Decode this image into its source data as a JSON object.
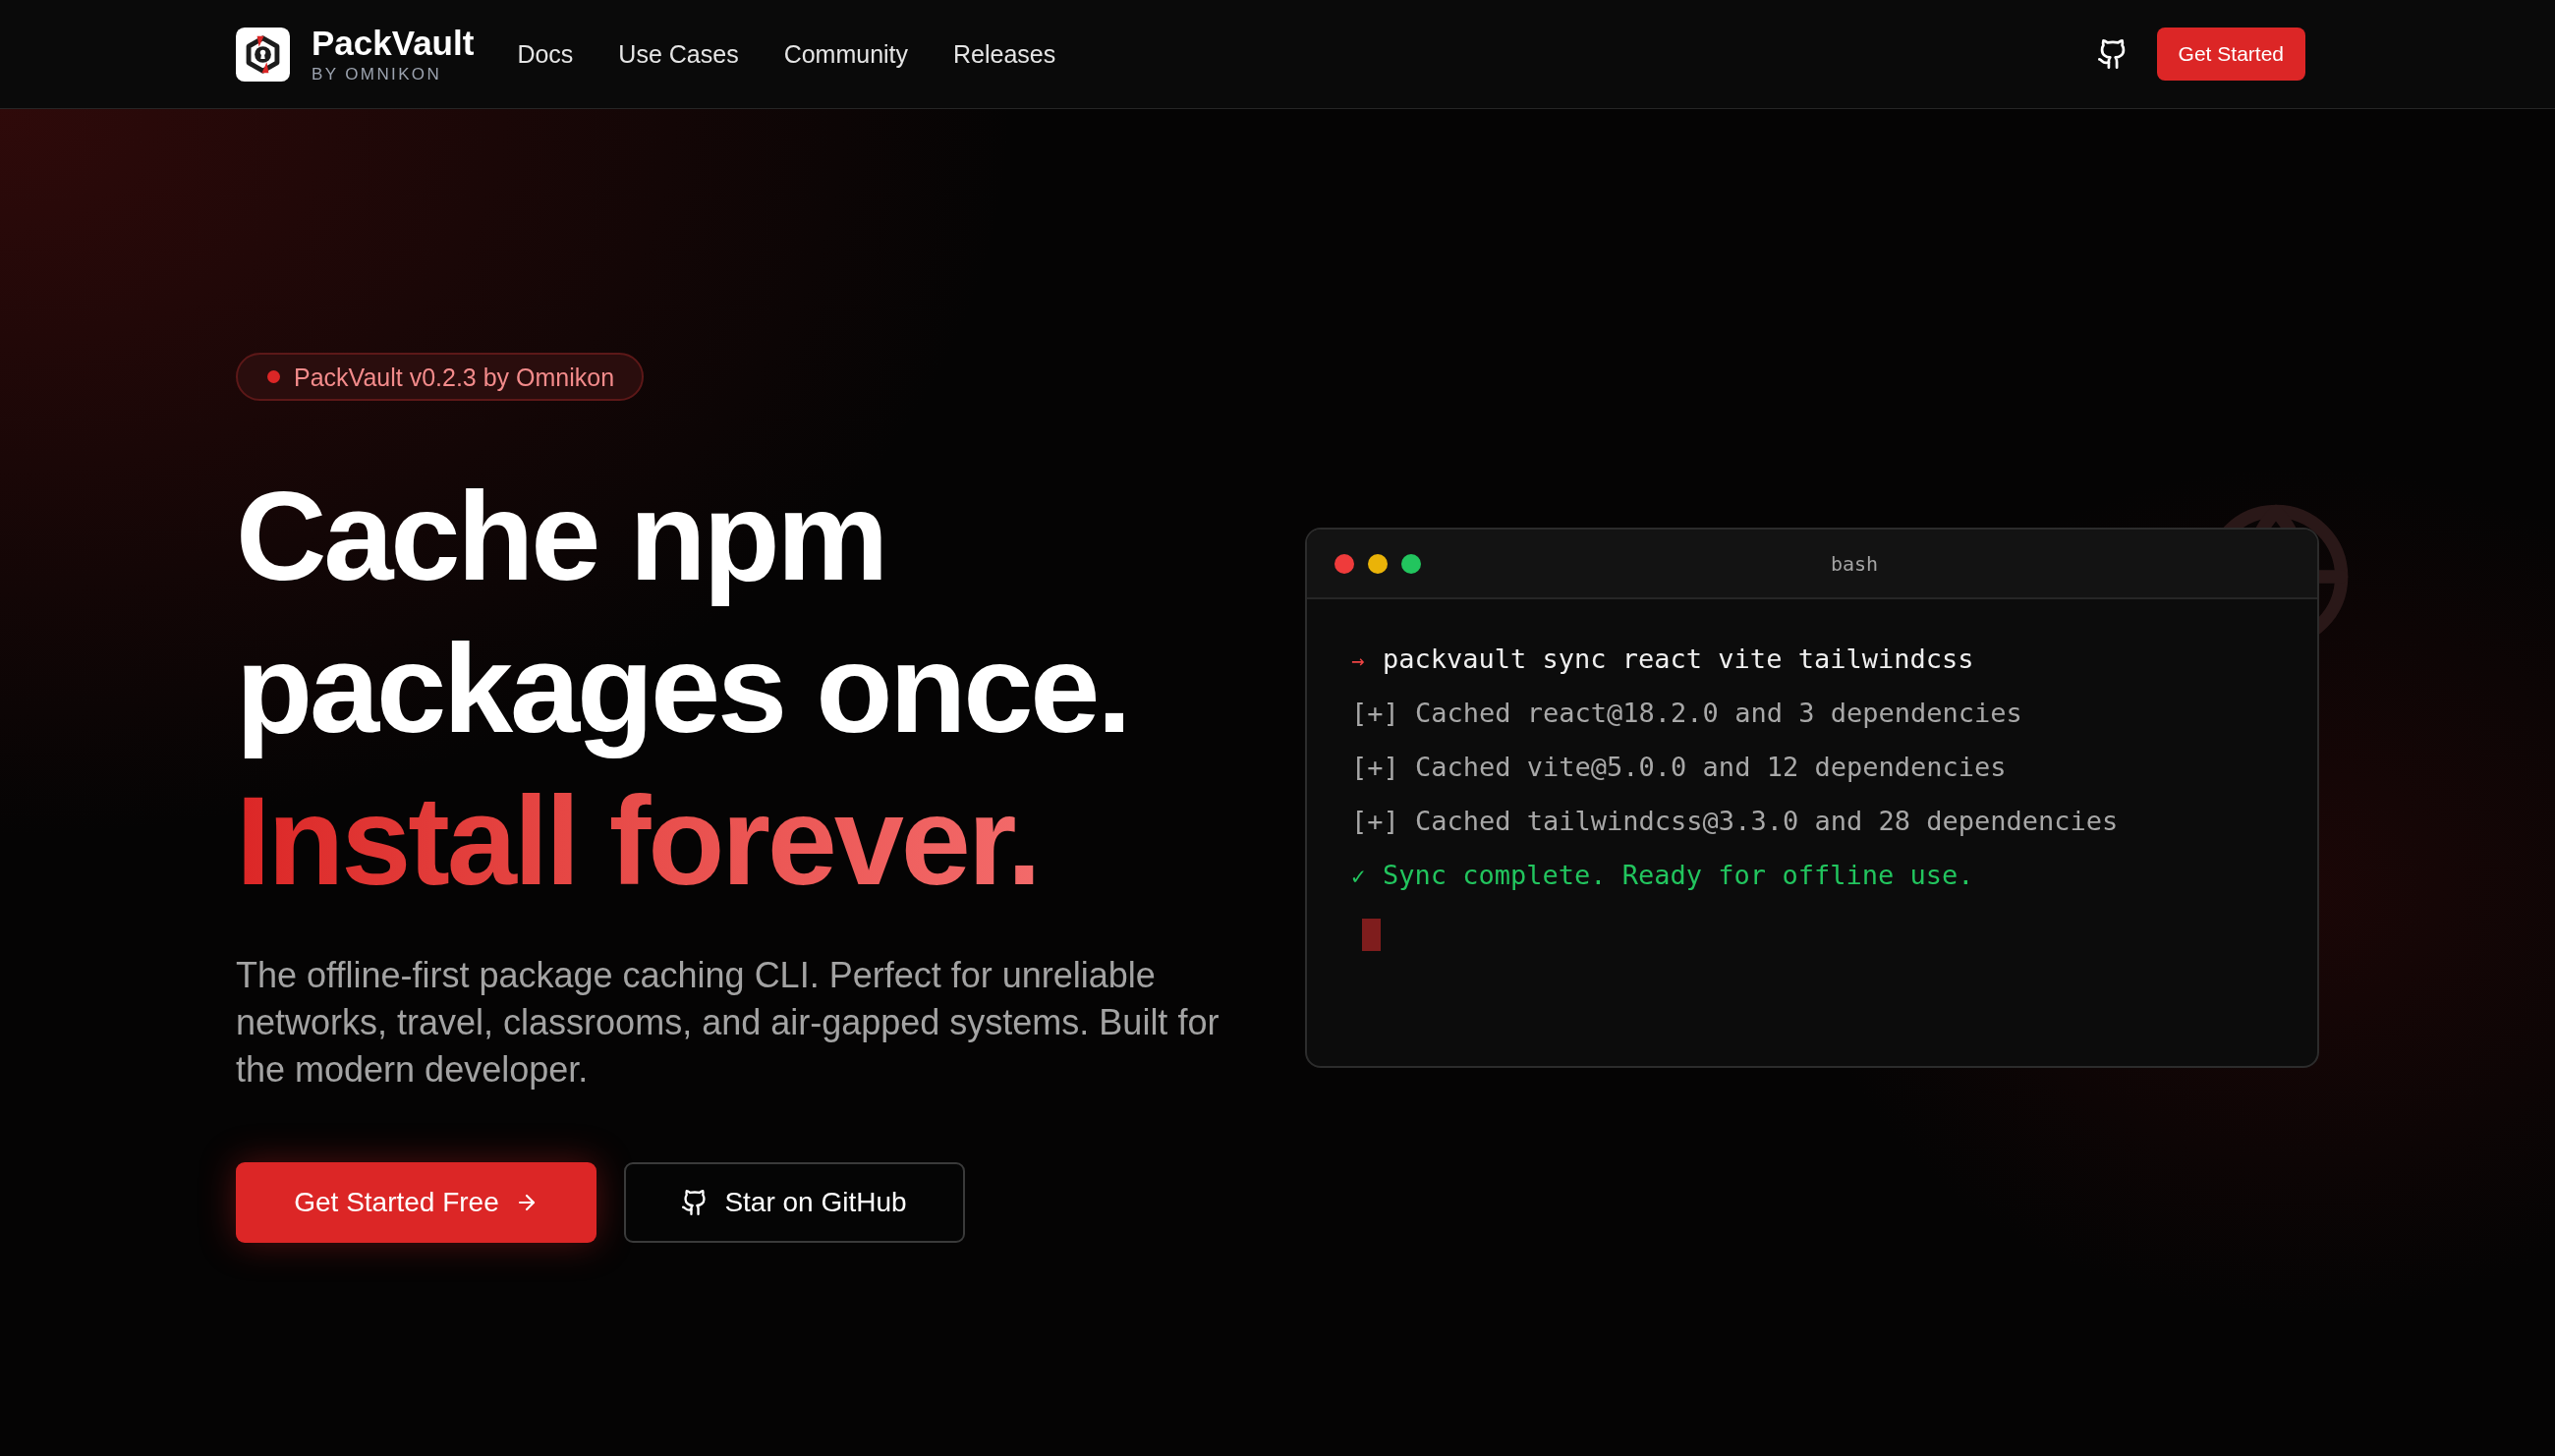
{
  "nav": {
    "brand": "PackVault",
    "byline": "BY OMNIKON",
    "links": [
      "Docs",
      "Use Cases",
      "Community",
      "Releases"
    ],
    "cta": "Get Started"
  },
  "hero": {
    "badge": "PackVault v0.2.3 by Omnikon",
    "heading": [
      {
        "text": "Cache npm",
        "kind": "plain"
      },
      {
        "text": "packages once.",
        "kind": "plain"
      },
      {
        "text": "Install forever.",
        "kind": "accent"
      }
    ],
    "description": "The offline-first package caching CLI. Perfect for unreliable networks, travel, classrooms, and air-gapped systems. Built for the modern developer.",
    "buttons": [
      {
        "label": "Get Started Free",
        "kind": "primary"
      },
      {
        "label": "Star on GitHub",
        "kind": "secondary"
      }
    ]
  },
  "terminal": {
    "title": "bash",
    "lines": [
      {
        "kind": "command",
        "prompt": "→",
        "text": "packvault sync react vite tailwindcss"
      },
      {
        "kind": "output",
        "text": "[+] Cached react@18.2.0 and 3 dependencies"
      },
      {
        "kind": "output",
        "text": "[+] Cached vite@5.0.0 and 12 dependencies"
      },
      {
        "kind": "output",
        "text": "[+] Cached tailwindcss@3.3.0 and 28 dependencies"
      },
      {
        "kind": "success",
        "prompt": "✓",
        "text": "Sync complete. Ready for offline use."
      }
    ],
    "cursor": true
  }
}
